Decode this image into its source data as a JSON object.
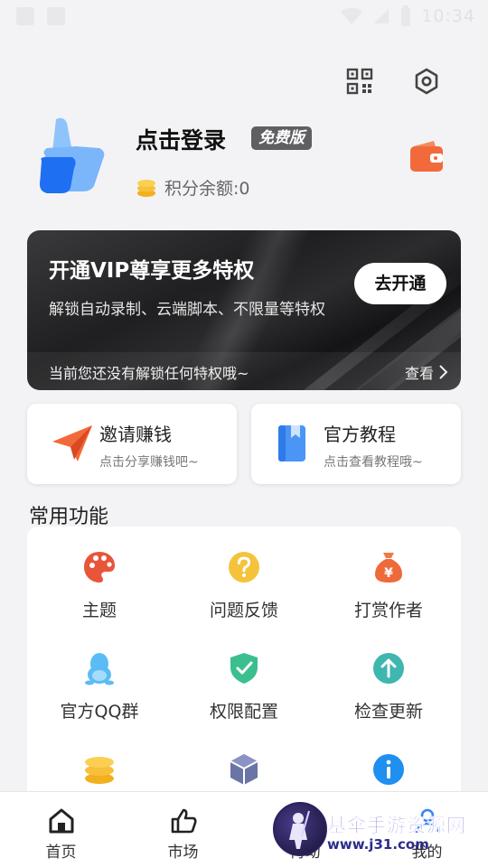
{
  "status_bar": {
    "time": "10:34"
  },
  "profile": {
    "login_text": "点击登录",
    "badge": "免费版",
    "points_label": "积分余额:0"
  },
  "vip": {
    "title": "开通VIP尊享更多特权",
    "subtitle": "解锁自动录制、云端脚本、不限量等特权",
    "button": "去开通",
    "footer_text": "当前您还没有解锁任何特权哦~",
    "more": "查看"
  },
  "cards": [
    {
      "title": "邀请赚钱",
      "subtitle": "点击分享赚钱吧~",
      "icon": "paper-plane-icon"
    },
    {
      "title": "官方教程",
      "subtitle": "点击查看教程哦~",
      "icon": "book-icon"
    }
  ],
  "section_title": "常用功能",
  "functions": [
    {
      "label": "主题",
      "icon": "palette-icon"
    },
    {
      "label": "问题反馈",
      "icon": "question-icon"
    },
    {
      "label": "打赏作者",
      "icon": "money-bag-icon"
    },
    {
      "label": "官方QQ群",
      "icon": "qq-penguin-icon"
    },
    {
      "label": "权限配置",
      "icon": "shield-check-icon"
    },
    {
      "label": "检查更新",
      "icon": "arrow-up-icon"
    },
    {
      "label": "",
      "icon": "coins-icon"
    },
    {
      "label": "",
      "icon": "cube-icon"
    },
    {
      "label": "",
      "icon": "info-icon"
    }
  ],
  "nav": [
    {
      "label": "首页",
      "icon": "home-icon"
    },
    {
      "label": "市场",
      "icon": "thumbs-up-icon"
    },
    {
      "label": "再动",
      "icon": "motion-icon"
    },
    {
      "label": "我的",
      "icon": "user-icon"
    }
  ],
  "watermark": {
    "title": "基伞手游资源网",
    "url": "www.j31.com"
  },
  "colors": {
    "brand_blue": "#3a82f7",
    "orange": "#f26a3c",
    "badge_gray": "#5f5f63"
  }
}
